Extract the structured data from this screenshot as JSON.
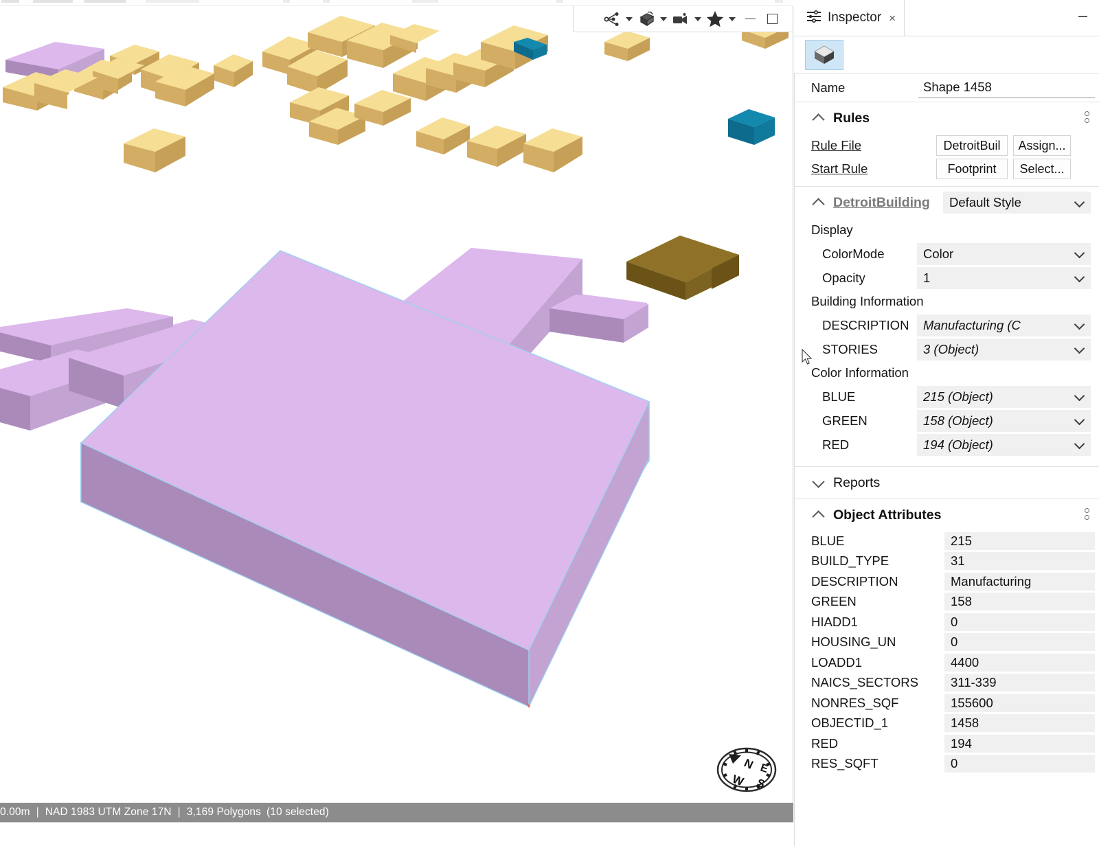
{
  "viewport": {
    "toolbar": [
      {
        "name": "share-graph-icon",
        "label": "Share"
      },
      {
        "name": "model-cube-icon",
        "label": "Model"
      },
      {
        "name": "camera-icon",
        "label": "Camera"
      },
      {
        "name": "star-icon",
        "label": "Bookmarks"
      }
    ],
    "minimize_label": "Minimize",
    "maximize_label": "Maximize",
    "compass": {
      "n": "N",
      "e": "E",
      "s": "S",
      "w": "W"
    }
  },
  "status_bar": {
    "elevation": "0.00m",
    "coordinate_system": "NAD 1983 UTM Zone 17N",
    "polygons": "3,169 Polygons",
    "selection": "(10 selected)",
    "separator": "|"
  },
  "inspector": {
    "tab_label": "Inspector",
    "tab_close": "×",
    "toolbar_icon": "cube-icon",
    "name_field": {
      "label": "Name",
      "value": "Shape 1458"
    },
    "rules": {
      "title": "Rules",
      "rows": [
        {
          "link": "Rule File",
          "value": "DetroitBuil",
          "action": "Assign..."
        },
        {
          "link": "Start Rule",
          "value": "Footprint",
          "action": "Select..."
        }
      ]
    },
    "style": {
      "rule_name": "DetroitBuilding",
      "style_value": "Default Style"
    },
    "groups": [
      {
        "label": "Display",
        "attributes": [
          {
            "key": "ColorMode",
            "value": "Color",
            "italic": false
          },
          {
            "key": "Opacity",
            "value": "1",
            "italic": false
          }
        ]
      },
      {
        "label": "Building Information",
        "attributes": [
          {
            "key": "DESCRIPTION",
            "value": "Manufacturing (C",
            "italic": true
          },
          {
            "key": "STORIES",
            "value": "3 (Object)",
            "italic": true
          }
        ]
      },
      {
        "label": "Color Information",
        "attributes": [
          {
            "key": "BLUE",
            "value": "215 (Object)",
            "italic": true
          },
          {
            "key": "GREEN",
            "value": "158 (Object)",
            "italic": true
          },
          {
            "key": "RED",
            "value": "194 (Object)",
            "italic": true
          }
        ]
      }
    ],
    "reports": {
      "title": "Reports"
    },
    "object_attributes": {
      "title": "Object Attributes",
      "rows": [
        {
          "key": "BLUE",
          "value": "215"
        },
        {
          "key": "BUILD_TYPE",
          "value": "31"
        },
        {
          "key": "DESCRIPTION",
          "value": "Manufacturing"
        },
        {
          "key": "GREEN",
          "value": "158"
        },
        {
          "key": "HIADD1",
          "value": "0"
        },
        {
          "key": "HOUSING_UN",
          "value": "0"
        },
        {
          "key": "LOADD1",
          "value": "4400"
        },
        {
          "key": "NAICS_SECTORS",
          "value": "311-339"
        },
        {
          "key": "NONRES_SQF",
          "value": "155600"
        },
        {
          "key": "OBJECTID_1",
          "value": "1458"
        },
        {
          "key": "RED",
          "value": "194"
        },
        {
          "key": "RES_SQFT",
          "value": "0"
        }
      ]
    }
  },
  "colors": {
    "selected_building_top": "#d9b3e8",
    "selected_building_side": "#a887b8",
    "house_roof": "#f5dd92",
    "house_wall": "#d0ab62",
    "teal_building": "#0f7fa3",
    "brown_building": "#7d6321",
    "status_bar_bg": "#8c8c8c",
    "accent_tab": "#cfe6f7"
  }
}
